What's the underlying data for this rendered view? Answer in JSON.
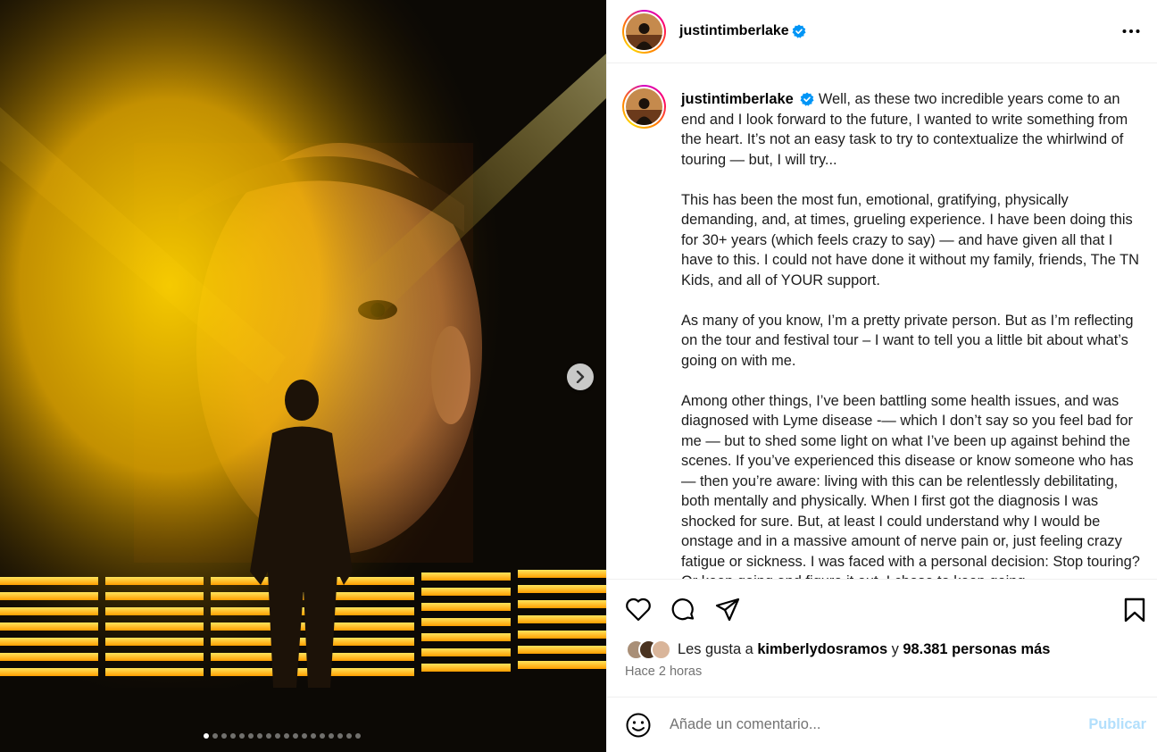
{
  "post": {
    "author": {
      "username": "justintimberlake",
      "verified": true
    },
    "caption": {
      "paragraphs": [
        "Well, as these two incredible years come to an end and I look forward to the future, I wanted to write something from the heart. It’s not an easy task to try to contextualize the whirlwind of touring — but, I will try...",
        "This has been the most fun, emotional, gratifying, physically demanding, and, at times, grueling experience. I have been doing this for 30+ years (which feels crazy to say) — and have given all that I have to this. I could not have done it without my family, friends, The TN Kids, and all of YOUR support.",
        "As many of you know, I’m a pretty private person. But as I’m reflecting on the tour and festival tour – I want to tell you a little bit about what’s going on with me.",
        "Among other things, I’ve been battling some health issues, and was diagnosed with Lyme disease -— which I don’t say so you feel bad for me — but to shed some light on what I’ve been up against behind the scenes. If you’ve experienced this disease or know someone who has — then you’re aware: living with this can be relentlessly debilitating, both mentally and physically. When I first got the diagnosis I was shocked for sure. But, at least I could understand why I would be onstage and in a massive amount of nerve pain or, just feeling crazy fatigue or sickness. I was faced with a personal decision: Stop touring? Or keep going and figure it out. I chose to keep going."
      ]
    },
    "carousel": {
      "total_slides": 18,
      "current_slide": 1
    },
    "likes": {
      "prefix": "Les gusta a",
      "first_liker": "kimberlydosramos",
      "joiner": "y",
      "others": "98.381 personas más"
    },
    "time_ago": "Hace 2 horas",
    "comment": {
      "placeholder": "Añade un comentario...",
      "publish_label": "Publicar"
    },
    "icons": {
      "like": "heart-icon",
      "comment": "comment-icon",
      "share": "share-icon",
      "save": "bookmark-icon",
      "more": "more-options-icon",
      "emoji": "emoji-icon",
      "next": "chevron-right-icon",
      "verified": "verified-badge-icon"
    },
    "colors": {
      "verified": "#0095f6",
      "publish_disabled": "#b2dffc",
      "muted": "#737373",
      "stage_light": "#ffc400"
    }
  }
}
